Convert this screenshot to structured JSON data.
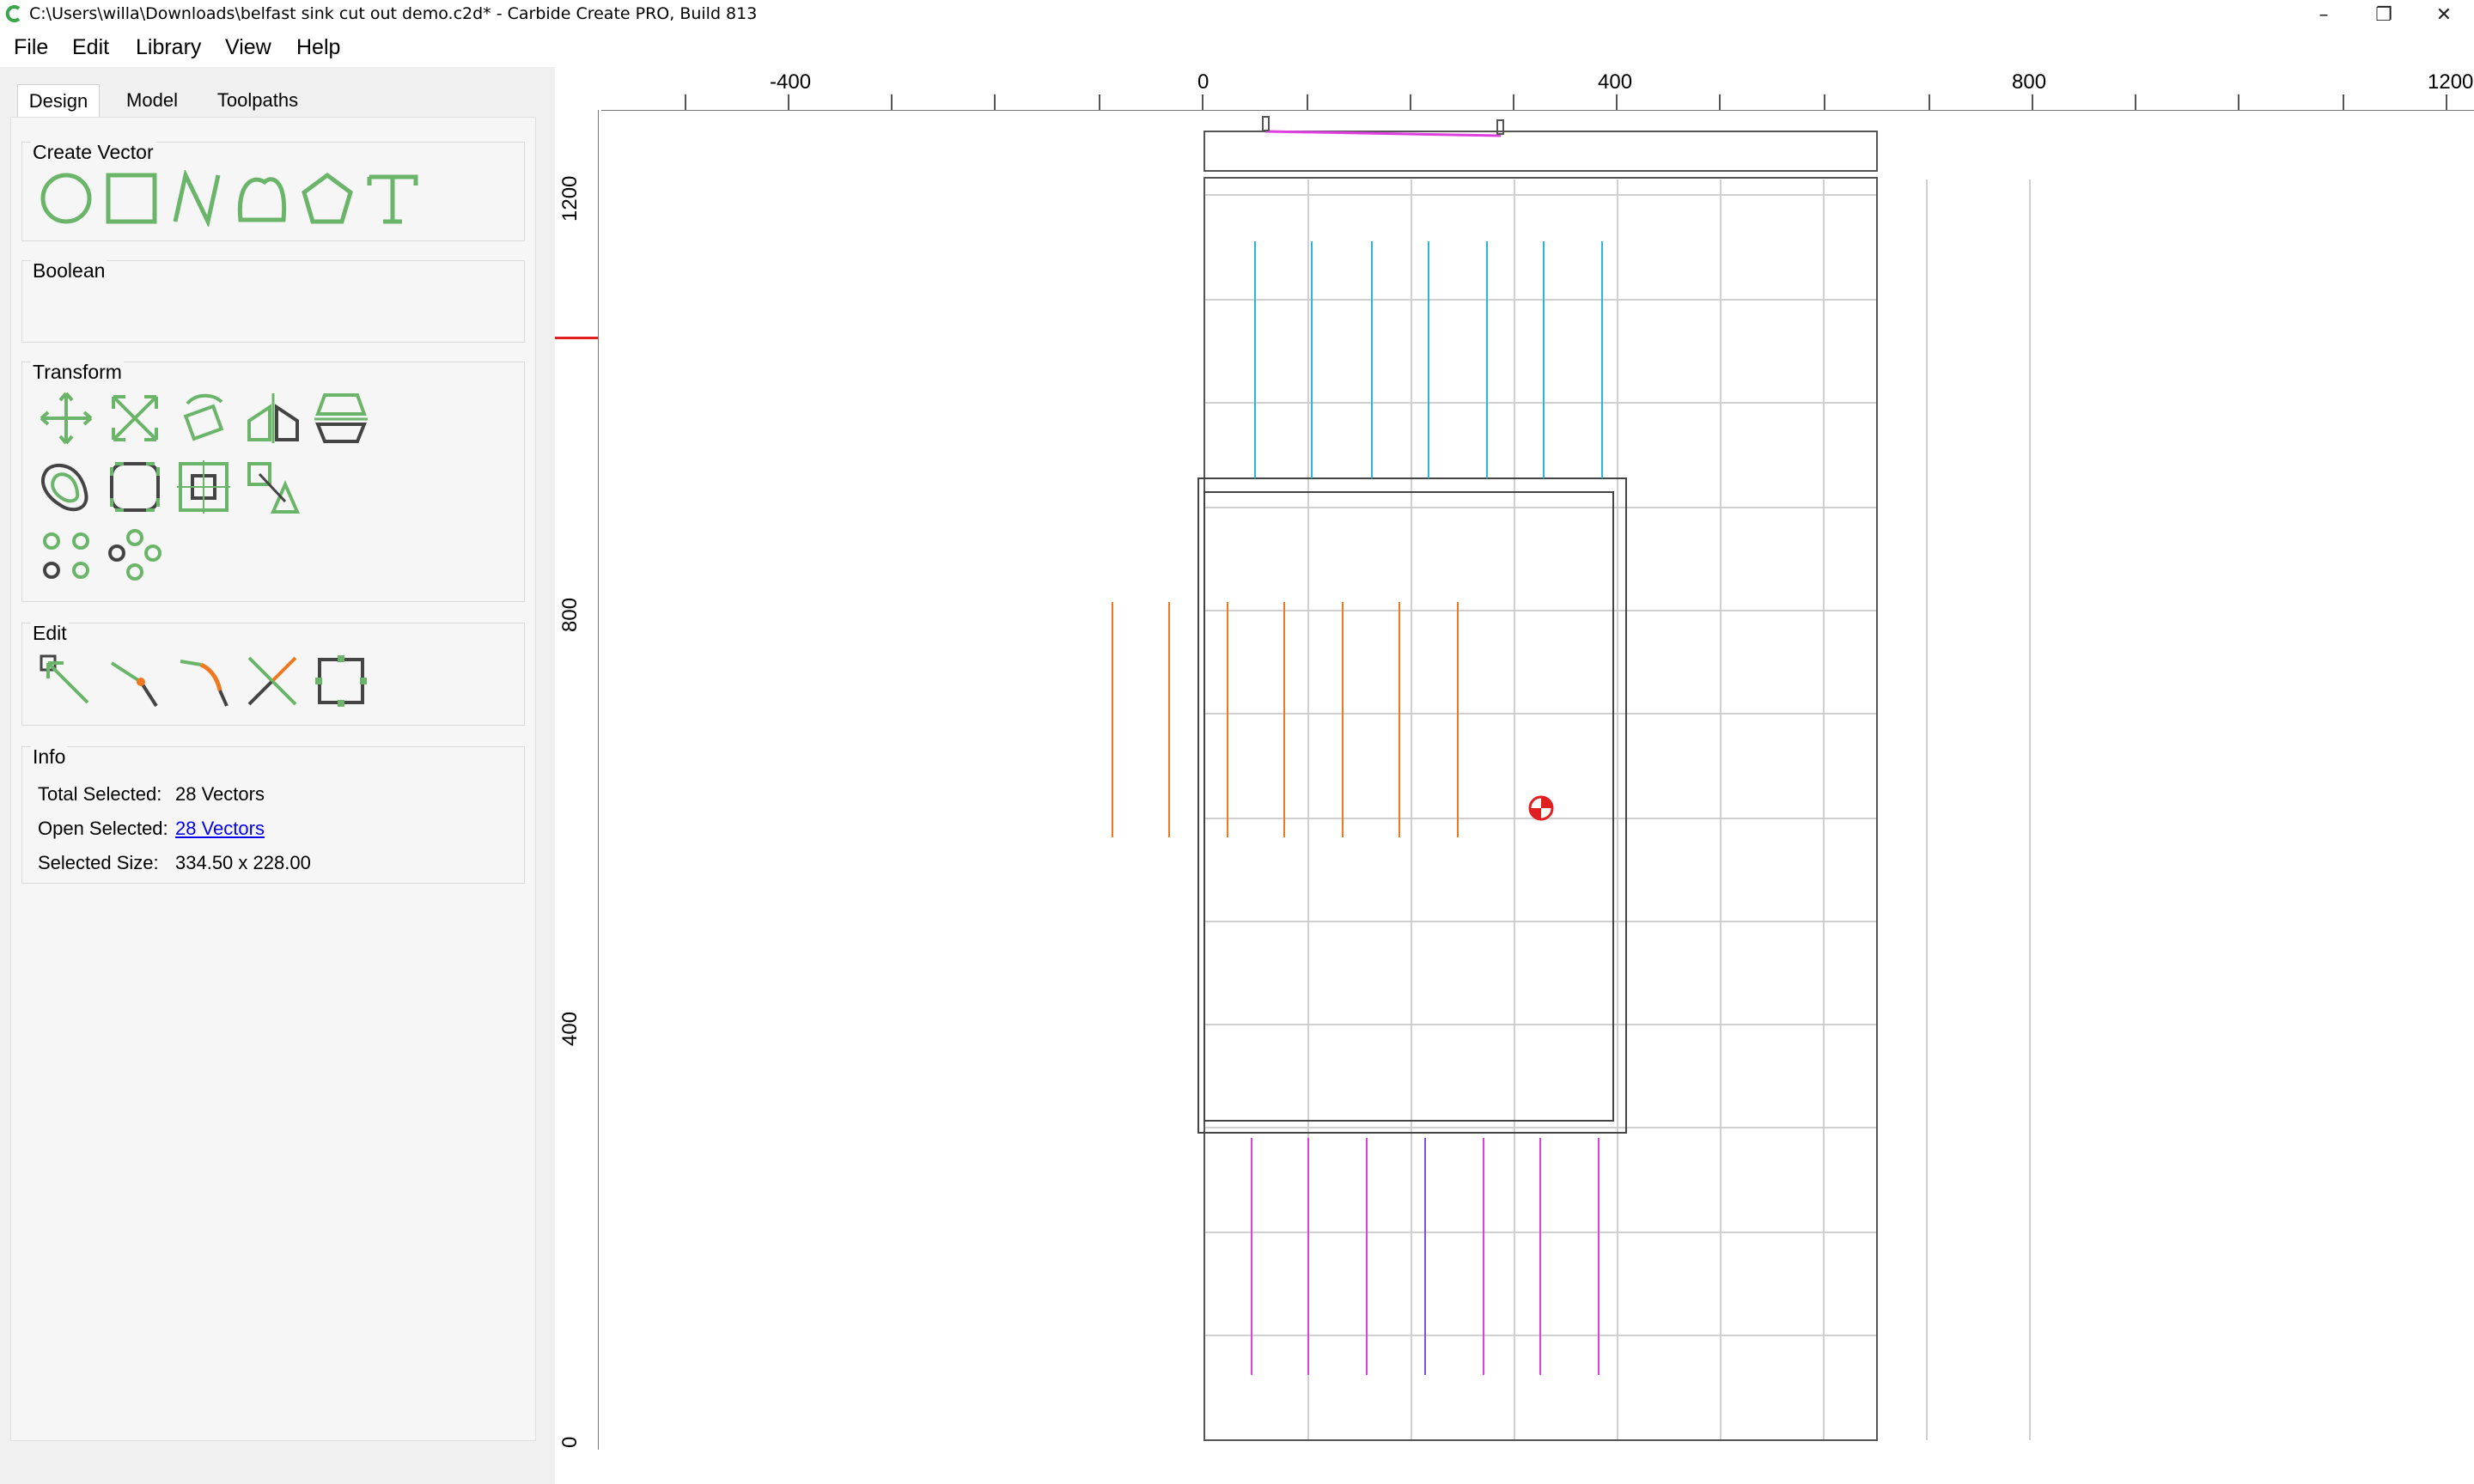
{
  "window": {
    "title": "C:\\Users\\willa\\Downloads\\belfast sink cut out demo.c2d* - Carbide Create PRO, Build 813",
    "controls": [
      "–",
      "❐",
      "✕"
    ]
  },
  "menu": [
    {
      "label": "File"
    },
    {
      "label": "Edit"
    },
    {
      "label": "Library"
    },
    {
      "label": "View"
    },
    {
      "label": "Help"
    }
  ],
  "tabs": [
    {
      "label": "Design",
      "active": true
    },
    {
      "label": "Model",
      "active": false
    },
    {
      "label": "Toolpaths",
      "active": false
    }
  ],
  "groups": {
    "create_vector": {
      "title": "Create Vector",
      "icons": [
        "circle-icon",
        "rectangle-icon",
        "polyline-icon",
        "curve-icon",
        "polygon-icon",
        "text-icon"
      ]
    },
    "boolean": {
      "title": "Boolean"
    },
    "transform": {
      "title": "Transform",
      "icons": [
        "move-icon",
        "scale-icon",
        "rotate-icon",
        "mirror-icon",
        "align-icon",
        "offset-icon",
        "fillet-icon",
        "center-icon",
        "snap-icon",
        "array-icon",
        "circular-array-icon"
      ]
    },
    "edit": {
      "title": "Edit",
      "icons": [
        "node-edit-icon",
        "split-icon",
        "join-icon",
        "trim-icon",
        "bounds-icon"
      ]
    },
    "info": {
      "title": "Info",
      "total_selected_label": "Total Selected:",
      "total_selected_value": "28 Vectors",
      "open_selected_label": "Open Selected:",
      "open_selected_value": "28 Vectors",
      "selected_size_label": "Selected Size:",
      "selected_size_value": "334.50 x 228.00"
    }
  },
  "rulers": {
    "top_labels": [
      "-400",
      "0",
      "400",
      "800",
      "1200"
    ],
    "left_labels": [
      "1200",
      "800",
      "400",
      "0"
    ]
  },
  "colors": {
    "accent_green": "#6ab56a",
    "cyan": "#29b8d8",
    "orange": "#f07820",
    "magenta": "#e040e0",
    "violet": "#8050e0",
    "grid": "#d0d0d0"
  }
}
